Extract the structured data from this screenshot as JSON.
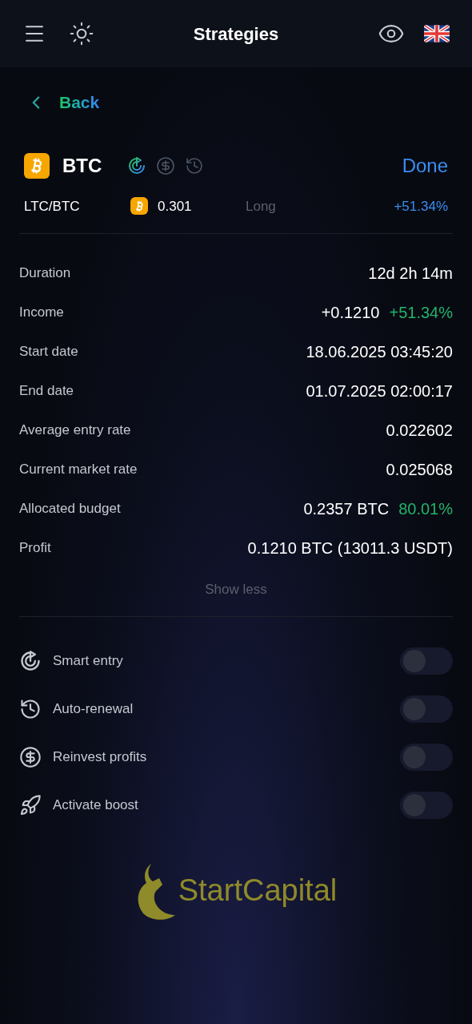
{
  "header": {
    "title": "Strategies"
  },
  "back": {
    "label": "Back"
  },
  "strategy": {
    "coin": "BTC",
    "status": "Done",
    "pair": "LTC/BTC",
    "amount": "0.301",
    "side": "Long",
    "change": "+51.34%",
    "features": [
      {
        "kind": "smart-entry",
        "active": true
      },
      {
        "kind": "reinvest",
        "active": false
      },
      {
        "kind": "auto-renewal",
        "active": false
      }
    ]
  },
  "details": [
    {
      "label": "Duration",
      "value": "12d 2h 14m"
    },
    {
      "label": "Income",
      "value": "+0.1210",
      "extra": "+51.34%"
    },
    {
      "label": "Start date",
      "value": "18.06.2025 03:45:20"
    },
    {
      "label": "End date",
      "value": "01.07.2025 02:00:17"
    },
    {
      "label": "Average entry rate",
      "value": "0.022602"
    },
    {
      "label": "Current market rate",
      "value": "0.025068"
    },
    {
      "label": "Allocated budget",
      "value": "0.2357 BTC",
      "extra": "80.01%"
    },
    {
      "label": "Profit",
      "value": "0.1210 BTC (13011.3 USDT)"
    }
  ],
  "show_less": "Show less",
  "settings": [
    {
      "kind": "smart-entry",
      "label": "Smart entry",
      "on": false
    },
    {
      "kind": "auto-renewal",
      "label": "Auto-renewal",
      "on": false
    },
    {
      "kind": "reinvest",
      "label": "Reinvest profits",
      "on": false
    },
    {
      "kind": "boost",
      "label": "Activate boost",
      "on": false
    }
  ],
  "logo": {
    "text": "StartCapital"
  }
}
